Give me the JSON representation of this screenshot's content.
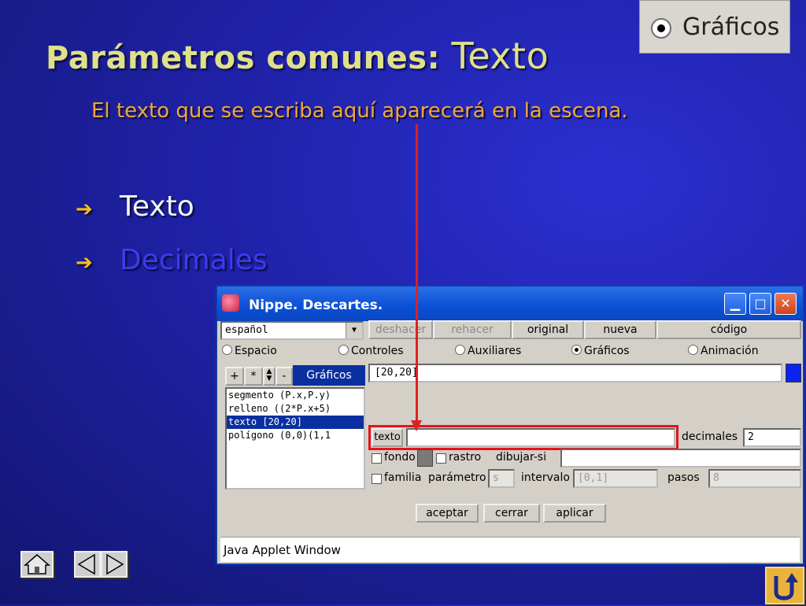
{
  "slide": {
    "title_prefix": "Parámetros comunes:",
    "title_suffix": "Texto",
    "subtitle": "El texto que se escriba aquí aparecerá en la escena.",
    "bullets": [
      "Texto",
      "Decimales"
    ]
  },
  "zoom_snippet": {
    "label": "Gráficos"
  },
  "applet": {
    "window_title": "Nippe. Descartes.",
    "language": "español",
    "toolbar": [
      "deshacer",
      "rehacer",
      "original",
      "nueva",
      "código"
    ],
    "radios": [
      "Espacio",
      "Controles",
      "Auxiliares",
      "Gráficos",
      "Animación"
    ],
    "selected_radio": "Gráficos",
    "list_buttons": [
      "+",
      "*",
      "-"
    ],
    "list_tab": "Gráficos",
    "list_items": [
      "segmento (P.x,P.y)",
      "relleno ((2*P.x+5)",
      "texto [20,20]",
      "polígono (0,0)(1,1"
    ],
    "selected_item": 2,
    "expr_value": "[20,20]",
    "texto_btn": "texto",
    "texto_value": "",
    "decimales_label": "decimales",
    "decimales_value": "2",
    "fondo_label": "fondo",
    "rastro_label": "rastro",
    "dibujar_si_label": "dibujar-si",
    "familia_label": "familia",
    "parametro_label": "parámetro",
    "parametro_value": "s",
    "intervalo_label": "intervalo",
    "intervalo_value": "[0,1]",
    "pasos_label": "pasos",
    "pasos_value": "8",
    "buttons": [
      "aceptar",
      "cerrar",
      "aplicar"
    ],
    "status": "Java Applet Window"
  },
  "colors": {
    "accent_red": "#e8121c",
    "selection_blue": "#0a2fa0",
    "title_yellow": "#dfe08a",
    "subtitle_orange": "#f0a63c"
  },
  "icons": [
    "home-icon",
    "prev-arrow-icon",
    "next-arrow-icon",
    "return-icon"
  ]
}
